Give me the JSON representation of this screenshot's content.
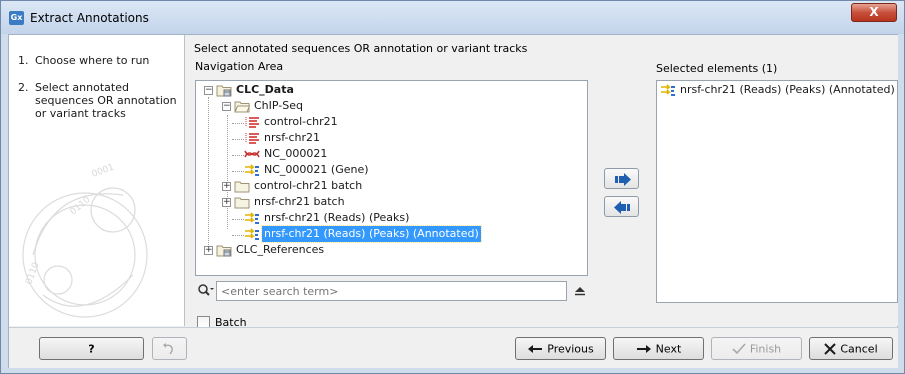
{
  "window": {
    "title": "Extract Annotations",
    "app_icon": "Gx",
    "close_glyph": "X"
  },
  "steps": [
    {
      "num": "1.",
      "label": "Choose where to run"
    },
    {
      "num": "2.",
      "label": "Select annotated sequences OR annotation or variant tracks"
    }
  ],
  "main": {
    "heading": "Select annotated sequences OR annotation or variant tracks",
    "nav_label": "Navigation Area",
    "selected_label": "Selected elements (1)",
    "tree": [
      {
        "label": "CLC_Data",
        "icon": "database-folder-icon",
        "bold": true,
        "expanded": true
      },
      {
        "label": "ChIP-Seq",
        "icon": "folder-icon",
        "expanded": true
      },
      {
        "label": "control-chr21",
        "icon": "reads-track-icon"
      },
      {
        "label": "nrsf-chr21",
        "icon": "reads-track-icon"
      },
      {
        "label": "NC_000021",
        "icon": "sequence-track-icon"
      },
      {
        "label": "NC_000021 (Gene)",
        "icon": "annotation-track-icon"
      },
      {
        "label": "control-chr21 batch",
        "icon": "folder-icon",
        "expanded": false
      },
      {
        "label": "nrsf-chr21 batch",
        "icon": "folder-icon",
        "expanded": false
      },
      {
        "label": "nrsf-chr21 (Reads) (Peaks)",
        "icon": "annotation-track-icon"
      },
      {
        "label": "nrsf-chr21 (Reads) (Peaks) (Annotated)",
        "icon": "annotation-track-icon",
        "selected": true
      },
      {
        "label": "CLC_References",
        "icon": "database-folder-icon",
        "expanded": false
      }
    ],
    "search_placeholder": "<enter search term>",
    "batch_label": "Batch",
    "batch_checked": false,
    "selected_elements": [
      {
        "label": "nrsf-chr21 (Reads) (Peaks) (Annotated)",
        "icon": "annotation-track-icon"
      }
    ]
  },
  "buttons": {
    "help": "?",
    "previous": "Previous",
    "next": "Next",
    "finish": "Finish",
    "cancel": "Cancel"
  },
  "colors": {
    "selection": "#3399ff",
    "window_frame": "#cfdcec",
    "reads_icon": "#d23232",
    "annotation_icon": "#e0b400"
  }
}
